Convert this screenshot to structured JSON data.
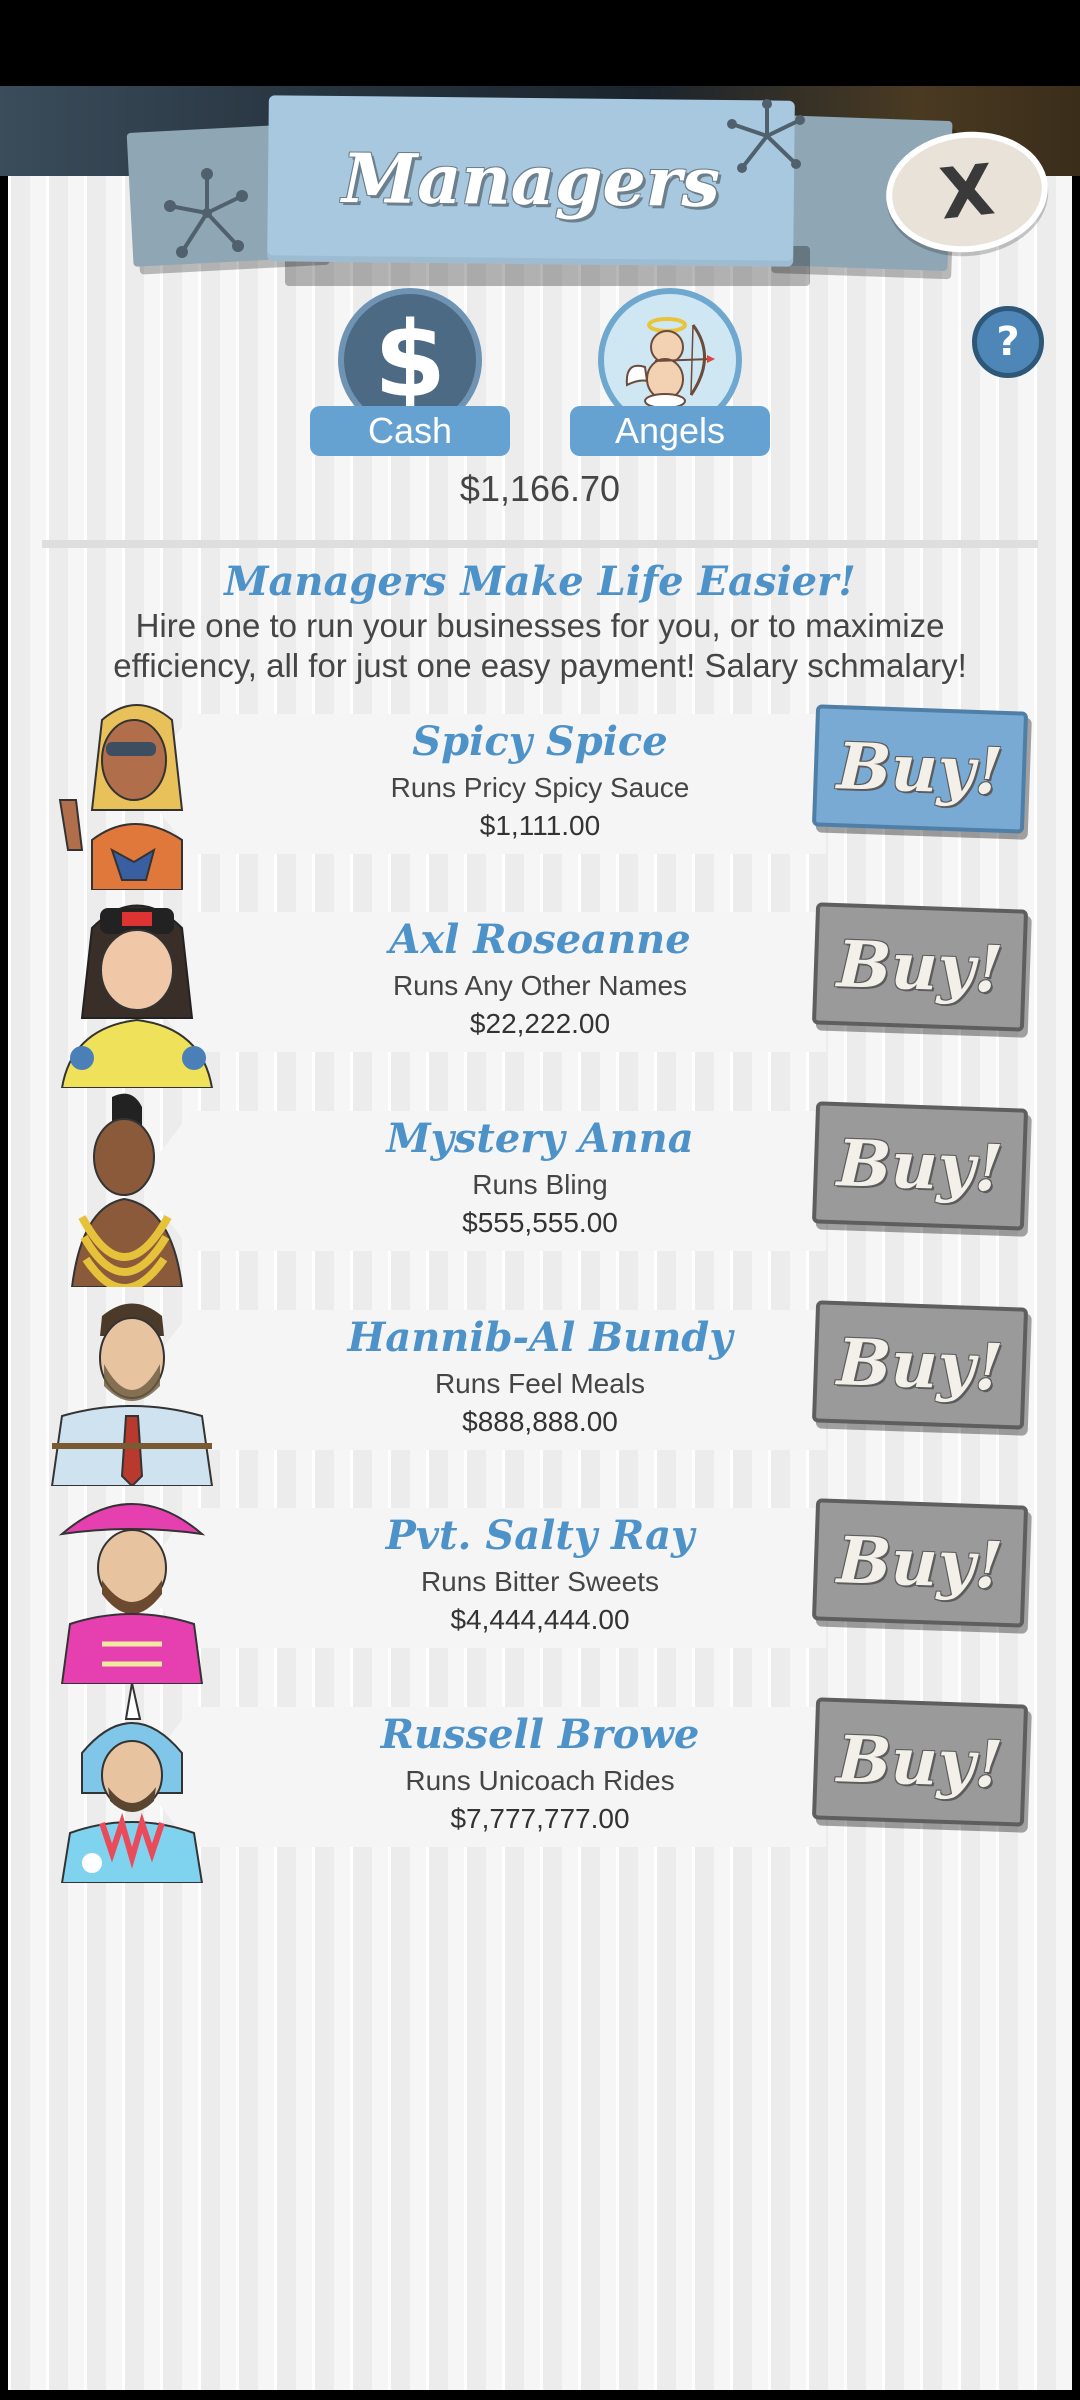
{
  "header": {
    "title": "Managers",
    "close_label": "X",
    "help_label": "?"
  },
  "tabs": [
    {
      "label": "Cash",
      "icon": "dollar-icon",
      "glyph": "$"
    },
    {
      "label": "Angels",
      "icon": "cupid-angel-icon"
    }
  ],
  "cash_amount": "$1,166.70",
  "promo": {
    "title": "Managers Make Life Easier!",
    "text": "Hire one to run your businesses for you, or to maximize efficiency, all for just one easy payment! Salary schmalary!"
  },
  "buy_label": "Buy!",
  "managers": [
    {
      "name": "Spicy Spice",
      "business": "Runs Pricy Spicy Sauce",
      "cost": "$1,111.00",
      "affordable": true
    },
    {
      "name": "Axl Roseanne",
      "business": "Runs Any Other Names",
      "cost": "$22,222.00",
      "affordable": false
    },
    {
      "name": "Mystery Anna",
      "business": "Runs Bling",
      "cost": "$555,555.00",
      "affordable": false
    },
    {
      "name": "Hannib-Al Bundy",
      "business": "Runs Feel Meals",
      "cost": "$888,888.00",
      "affordable": false
    },
    {
      "name": "Pvt. Salty Ray",
      "business": "Runs Bitter Sweets",
      "cost": "$4,444,444.00",
      "affordable": false
    },
    {
      "name": "Russell Browe",
      "business": "Runs Unicoach Rides",
      "cost": "$7,777,777.00",
      "affordable": false
    }
  ],
  "colors": {
    "accent": "#4d92c8",
    "buy_active": "#79aad3",
    "buy_inactive": "#9a9a9a",
    "header": "#a8c8df"
  }
}
